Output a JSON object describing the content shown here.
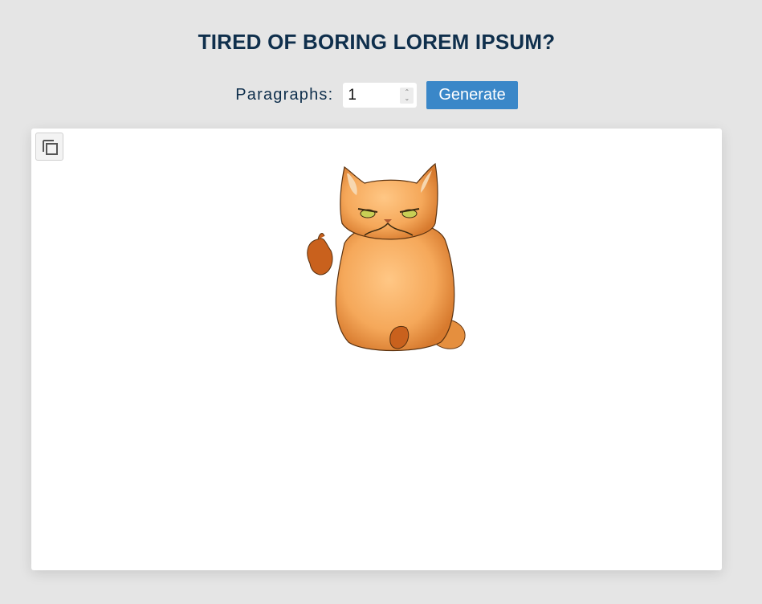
{
  "header": {
    "title": "TIRED OF BORING LOREM IPSUM?"
  },
  "controls": {
    "paragraphs_label": "Paragraphs:",
    "paragraphs_value": "1",
    "generate_label": "Generate"
  },
  "panel": {
    "copy_icon": "copy-icon",
    "image": "grumpy-cat-thumbs-up-illustration"
  },
  "colors": {
    "background": "#e5e5e5",
    "title": "#0f2f4c",
    "button": "#3a87c8",
    "panel": "#ffffff"
  }
}
